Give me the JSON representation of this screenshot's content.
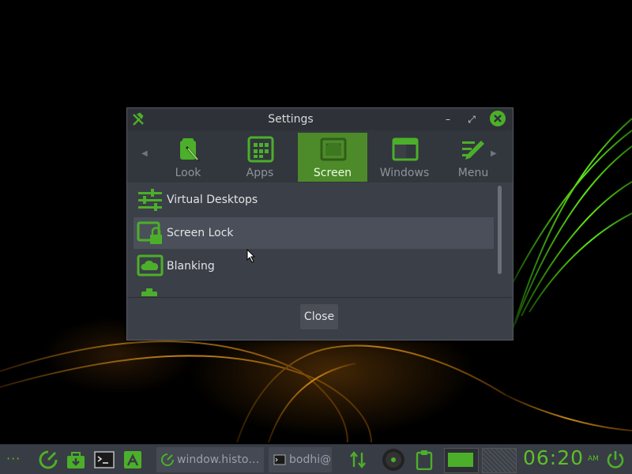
{
  "window": {
    "title": "Settings",
    "minimize_symbol": "–",
    "maximize_symbol": "⤢",
    "close_symbol": "✕"
  },
  "tabs": [
    {
      "label": "Look",
      "icon": "look-icon",
      "active": false
    },
    {
      "label": "Apps",
      "icon": "apps-grid-icon",
      "active": false
    },
    {
      "label": "Screen",
      "icon": "screen-icon",
      "active": true
    },
    {
      "label": "Windows",
      "icon": "window-icon",
      "active": false
    },
    {
      "label": "Menu",
      "icon": "menu-pencil-icon",
      "active": false
    }
  ],
  "list": {
    "items": [
      {
        "label": "Virtual Desktops",
        "icon": "sliders-icon",
        "selected": false
      },
      {
        "label": "Screen Lock",
        "icon": "screen-lock-icon",
        "selected": true
      },
      {
        "label": "Blanking",
        "icon": "blanking-icon",
        "selected": false
      }
    ]
  },
  "footer": {
    "close_label": "Close"
  },
  "taskbar": {
    "dots": "···",
    "tasks": [
      {
        "label": "window.histo…",
        "icon": "window-history-icon"
      },
      {
        "label": "bodhi@",
        "icon": "terminal-icon"
      }
    ],
    "clock": "06:20",
    "clock_ampm": "AM"
  },
  "colors": {
    "accent": "#4caf2a",
    "window_bg": "#3b3f47",
    "titlebar_bg": "#2e3138",
    "active_tab_bg": "#4d8a2a"
  }
}
